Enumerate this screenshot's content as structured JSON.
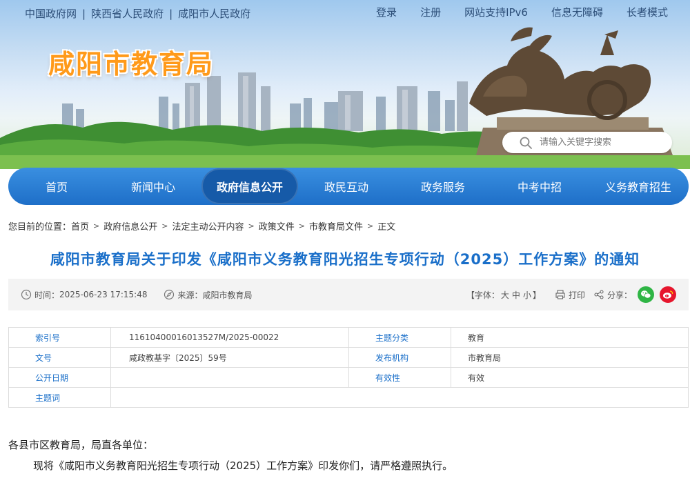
{
  "topbar": {
    "left_links": [
      "中国政府网",
      "陕西省人民政府",
      "咸阳市人民政府"
    ],
    "right_links": [
      "登录",
      "注册",
      "网站支持IPv6",
      "信息无障碍",
      "长者模式"
    ]
  },
  "site": {
    "title": "咸阳市教育局"
  },
  "search": {
    "placeholder": "请输入关键字搜索"
  },
  "nav": {
    "items": [
      "首页",
      "新闻中心",
      "政府信息公开",
      "政民互动",
      "政务服务",
      "中考中招",
      "义务教育招生"
    ],
    "active_index": 2
  },
  "breadcrumb": {
    "prefix": "您目前的位置：",
    "items": [
      "首页",
      "政府信息公开",
      "法定主动公开内容",
      "政策文件",
      "市教育局文件",
      "正文"
    ]
  },
  "article": {
    "title": "咸阳市教育局关于印发《咸阳市义务教育阳光招生专项行动（2025）工作方案》的通知"
  },
  "meta": {
    "time_label": "时间：",
    "time": "2025-06-23 17:15:48",
    "source_label": "来源：",
    "source": "咸阳市教育局",
    "font_label": "【字体：",
    "font_sizes": [
      "大",
      "中",
      "小"
    ],
    "font_end": "】",
    "print": "打印",
    "share": "分享："
  },
  "info": {
    "rows": [
      {
        "label1": "索引号",
        "value1": "116104000160135​27M/2025-00022",
        "label2": "主题分类",
        "value2": "教育"
      },
      {
        "label1": "文号",
        "value1": "咸政教基字〔2025〕59号",
        "label2": "发布机构",
        "value2": "市教育局"
      },
      {
        "label1": "公开日期",
        "value1": "",
        "label2": "有效性",
        "value2": "有效"
      },
      {
        "label1": "主题词",
        "value1": ""
      }
    ]
  },
  "body": {
    "salutation": "各县市区教育局，局直各单位：",
    "paragraph1": "现将《咸阳市义务教育阳光招生专项行动（2025）工作方案》印发你们，请严格遵照执行。"
  },
  "colors": {
    "nav_blue": "#1e6fc9",
    "title_blue": "#1a6fc9",
    "site_title_orange": "#ff9a1a",
    "wechat_green": "#2fb545",
    "weibo_red": "#e6162d"
  }
}
